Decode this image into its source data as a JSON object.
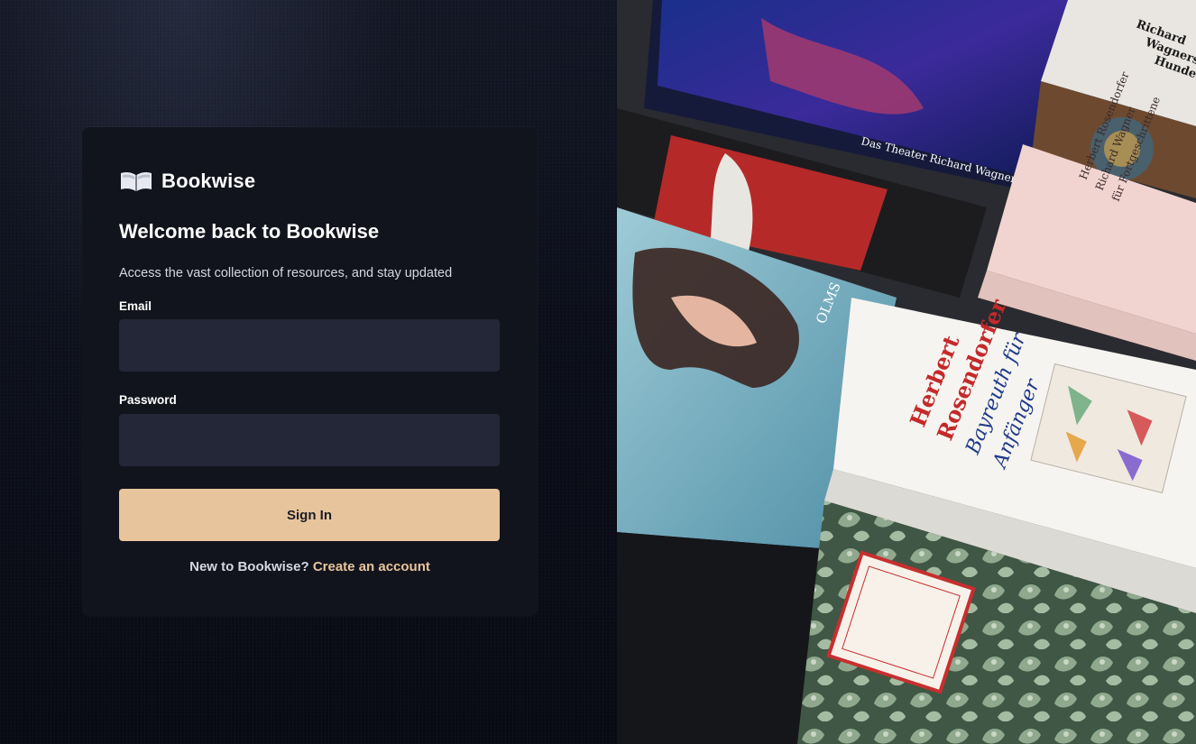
{
  "brand": {
    "name": "Bookwise",
    "logo_icon": "open-book-icon"
  },
  "login": {
    "title": "Welcome back to Bookwise",
    "subtitle": "Access the vast collection of resources, and stay updated",
    "email_label": "Email",
    "email_value": "",
    "password_label": "Password",
    "password_value": "",
    "submit_label": "Sign In",
    "footer_text": "New to Bookwise?",
    "footer_link": "Create an account"
  },
  "illustration": {
    "books": [
      {
        "lines": [
          "Das Theater Richard Wagners"
        ]
      },
      {
        "lines": [
          "Richard",
          "Wagners",
          "Hunde"
        ]
      },
      {
        "lines": [
          "Herbert Rosendorfer",
          "Richard Wagner",
          "für Fortgeschrittene"
        ]
      },
      {
        "lines": [
          "Herbert",
          "Rosendorfer",
          "Bayreuth für",
          "Anfänger"
        ]
      },
      {
        "lines": [
          "OLMS"
        ]
      }
    ]
  },
  "colors": {
    "accent": "#e8c49c",
    "card_bg": "#12141d",
    "input_bg": "#232738",
    "page_bg": "#0b0e17"
  }
}
